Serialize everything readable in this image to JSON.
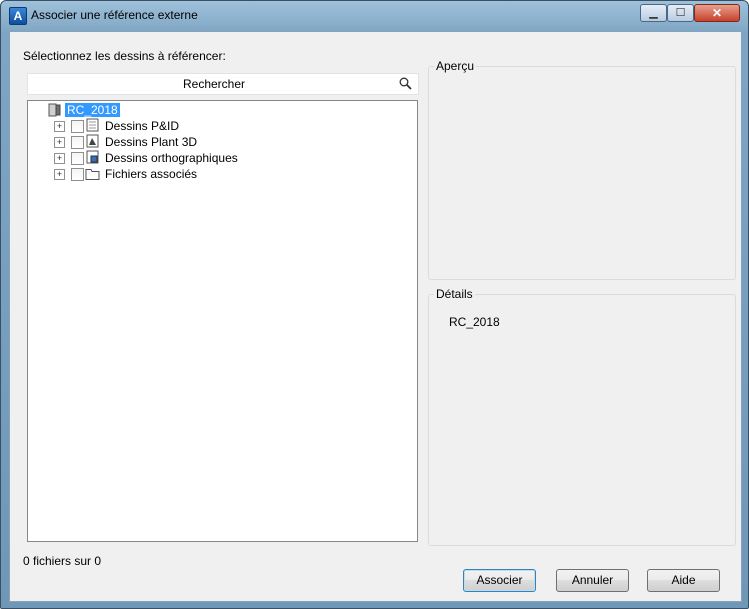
{
  "window": {
    "title": "Associer une référence externe",
    "app_icon_letter": "A"
  },
  "left_panel": {
    "instruction": "Sélectionnez les dessins à référencer:",
    "search_placeholder": "Rechercher"
  },
  "tree": {
    "root": {
      "label": "RC_2018",
      "icon": "project-icon",
      "selected": true
    },
    "children": [
      {
        "label": "Dessins P&ID",
        "icon": "pid-drawing-icon",
        "checked": false,
        "expandable": true
      },
      {
        "label": "Dessins Plant 3D",
        "icon": "plant3d-drawing-icon",
        "checked": false,
        "expandable": true
      },
      {
        "label": "Dessins orthographiques",
        "icon": "ortho-drawing-icon",
        "checked": false,
        "expandable": true
      },
      {
        "label": "Fichiers associés",
        "icon": "folder-icon",
        "checked": false,
        "expandable": true
      }
    ]
  },
  "preview": {
    "label": "Aperçu"
  },
  "details": {
    "label": "Détails",
    "value": "RC_2018"
  },
  "status": {
    "file_count": "0 fichiers sur 0"
  },
  "buttons": {
    "attach": "Associer",
    "cancel": "Annuler",
    "help": "Aide"
  },
  "colors": {
    "selection": "#3399ff",
    "titlebar": "#9fc1da"
  }
}
